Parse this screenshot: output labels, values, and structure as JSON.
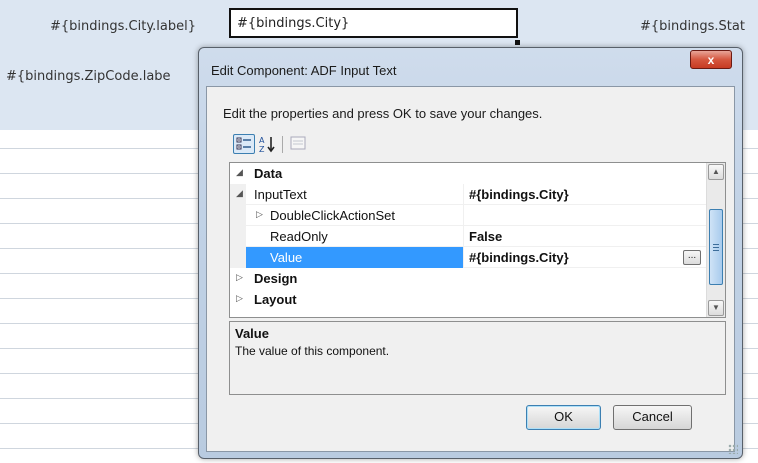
{
  "background": {
    "city_label": "#{bindings.City.label}",
    "city_field_value": "#{bindings.City}",
    "state_label_partial": "#{bindings.Stat",
    "zipcode_label_partial": "#{bindings.ZipCode.labe"
  },
  "dialog": {
    "title": "Edit Component: ADF Input Text",
    "close_glyph": "x",
    "instructions": "Edit the properties and press OK to save your changes.",
    "toolbar": {
      "categorized_icon": "categorized-view-icon",
      "alphabetical_icon": "alphabetical-sort-icon",
      "property_pages_icon": "property-pages-icon"
    },
    "grid": {
      "rows": [
        {
          "kind": "category",
          "name": "Data",
          "expander": "◢",
          "expanded": true
        },
        {
          "kind": "property",
          "name": "InputText",
          "value": "#{bindings.City}",
          "expander": "◢",
          "expanded": true
        },
        {
          "kind": "property",
          "name": "DoubleClickActionSet",
          "value": "",
          "expander": "▷",
          "expanded": false
        },
        {
          "kind": "property",
          "name": "ReadOnly",
          "value": "False"
        },
        {
          "kind": "property",
          "name": "Value",
          "value": "#{bindings.City}",
          "selected": true,
          "ellipsis": "..."
        },
        {
          "kind": "category",
          "name": "Design",
          "expander": "▷",
          "expanded": false
        },
        {
          "kind": "category",
          "name": "Layout",
          "expander": "▷",
          "expanded": false
        }
      ],
      "scroll_up": "▲",
      "scroll_down": "▼"
    },
    "description": {
      "title": "Value",
      "text": "The value of this component."
    },
    "buttons": {
      "ok": "OK",
      "cancel": "Cancel"
    }
  }
}
